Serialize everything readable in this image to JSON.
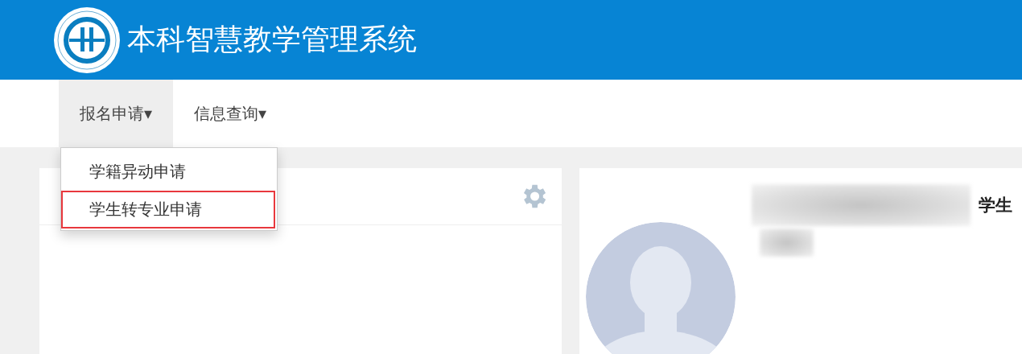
{
  "header": {
    "title": "本科智慧教学管理系统"
  },
  "nav": [
    {
      "label": "报名申请",
      "selected": true,
      "caret": "▾",
      "menu": [
        {
          "label": "学籍异动申请",
          "selected": false
        },
        {
          "label": "学生转专业申请",
          "selected": true
        }
      ]
    },
    {
      "label": "信息查询",
      "selected": false,
      "caret": "▾"
    }
  ],
  "profile": {
    "role": "学生"
  }
}
